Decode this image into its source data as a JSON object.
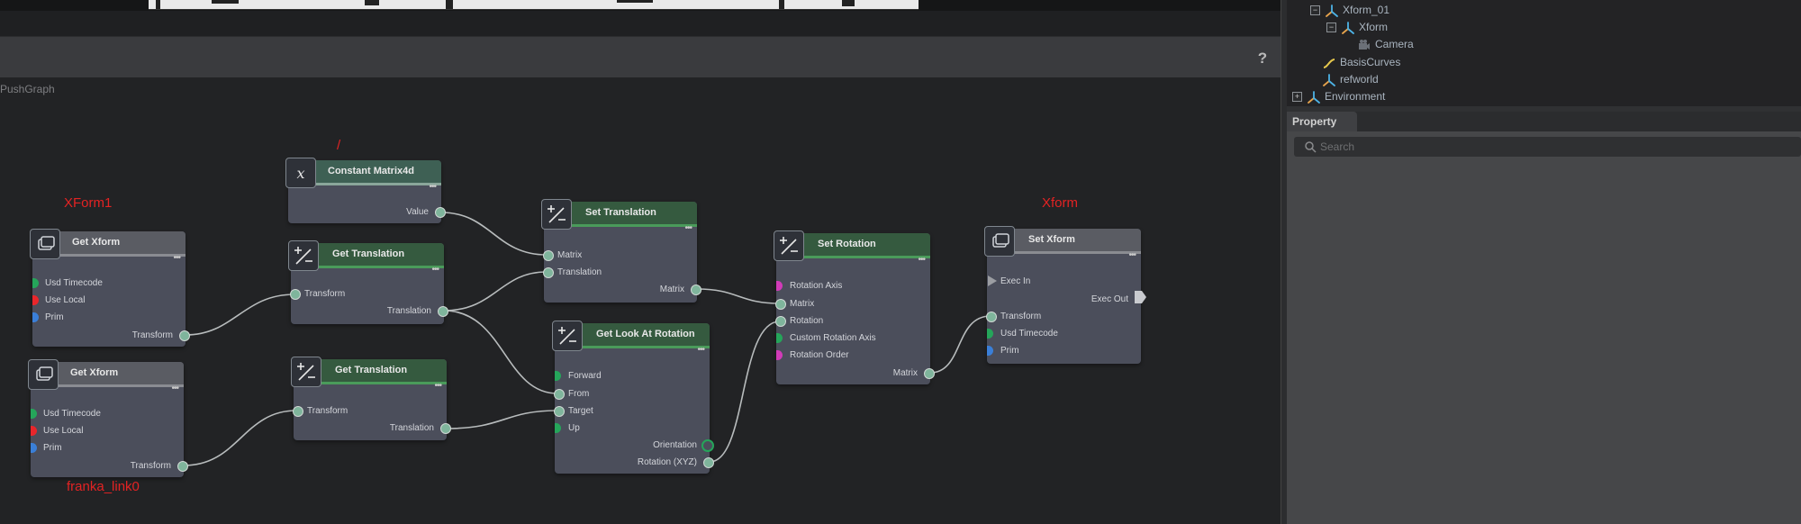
{
  "graph": {
    "name": "PushGraph",
    "help_label": "?"
  },
  "stage_tree": [
    {
      "label": "Xform_01",
      "toggle": "−",
      "icon": "xform-icon"
    },
    {
      "label": "Xform",
      "toggle": "−",
      "icon": "xform-icon"
    },
    {
      "label": "Camera",
      "toggle": "",
      "icon": "camera-icon"
    },
    {
      "label": "BasisCurves",
      "toggle": "",
      "icon": "curve-icon"
    },
    {
      "label": "refworld",
      "toggle": "",
      "icon": "xform-icon"
    },
    {
      "label": "Environment",
      "toggle": "+",
      "icon": "xform-icon"
    }
  ],
  "property": {
    "tab_label": "Property",
    "search_placeholder": "Search"
  },
  "annotations": {
    "xform1": "XForm1",
    "slash": "/",
    "xform": "Xform",
    "franka": "franka_link0"
  },
  "nodes": {
    "get_xform_1": {
      "title": "Get Xform",
      "inputs": [
        "Usd Timecode",
        "Use Local",
        "Prim"
      ],
      "output": "Transform"
    },
    "get_xform_2": {
      "title": "Get Xform",
      "inputs": [
        "Usd Timecode",
        "Use Local",
        "Prim"
      ],
      "output": "Transform"
    },
    "constant_matrix": {
      "title": "Constant Matrix4d",
      "output": "Value"
    },
    "get_translation_1": {
      "title": "Get Translation",
      "input": "Transform",
      "output": "Translation"
    },
    "get_translation_2": {
      "title": "Get Translation",
      "input": "Transform",
      "output": "Translation"
    },
    "set_translation": {
      "title": "Set Translation",
      "inputs": [
        "Matrix",
        "Translation"
      ],
      "output": "Matrix"
    },
    "get_look_at_rotation": {
      "title": "Get Look At Rotation",
      "inputs": [
        "Forward",
        "From",
        "Target",
        "Up"
      ],
      "outputs": [
        "Orientation",
        "Rotation (XYZ)"
      ]
    },
    "set_rotation": {
      "title": "Set Rotation",
      "inputs": [
        "Rotation Axis",
        "Matrix",
        "Rotation",
        "Custom Rotation Axis",
        "Rotation Order"
      ],
      "output": "Matrix"
    },
    "set_xform": {
      "title": "Set Xform",
      "inputs": [
        "Exec In",
        "Transform",
        "Usd Timecode",
        "Prim"
      ],
      "outputs": [
        "Exec Out"
      ]
    }
  },
  "colors": {
    "pin_green": "#25a55a",
    "pin_red": "#e8262b",
    "pin_blue": "#3a7fd8",
    "pin_magenta": "#d13bb8",
    "pin_teal": "#7fb59c",
    "wire": "#b8bcbd",
    "annotation": "#e32323"
  }
}
